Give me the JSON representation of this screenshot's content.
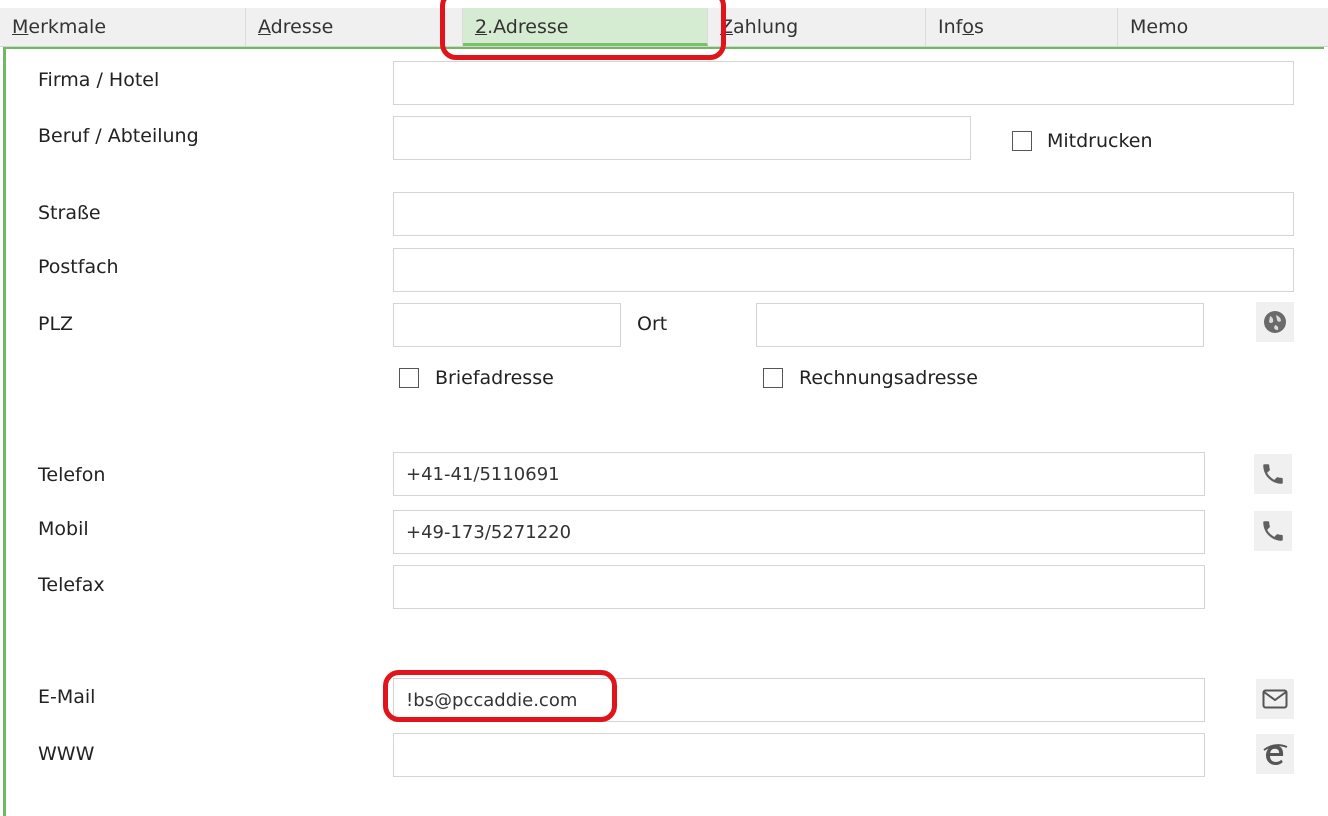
{
  "tabs": [
    {
      "pre": "",
      "ul": "M",
      "post": "erkmale"
    },
    {
      "pre": "",
      "ul": "A",
      "post": "dresse"
    },
    {
      "pre": "",
      "ul": "2",
      "post": ".Adresse"
    },
    {
      "pre": "",
      "ul": "Z",
      "post": "ahlung"
    },
    {
      "pre": "Inf",
      "ul": "o",
      "post": "s"
    },
    {
      "pre": "Memo",
      "ul": "",
      "post": ""
    }
  ],
  "form": {
    "firma_label": "Firma / Hotel",
    "beruf_label": "Beruf / Abteilung",
    "mitdrucken_label": "Mitdrucken",
    "strasse_label": "Straße",
    "postfach_label": "Postfach",
    "plz_label": "PLZ",
    "ort_label": "Ort",
    "briefadresse_label": "Briefadresse",
    "rechnungsadresse_label": "Rechnungsadresse",
    "telefon_label": "Telefon",
    "telefon_value": "+41-41/5110691",
    "mobil_label": "Mobil",
    "mobil_value": "+49-173/5271220",
    "telefax_label": "Telefax",
    "email_label": "E-Mail",
    "email_value": "!bs@pccaddie.com",
    "www_label": "WWW"
  },
  "colors": {
    "active_tab": "#d6ecd2",
    "panel_border": "#6dbb5e",
    "highlight": "#e0141a"
  },
  "icons": [
    "globe-icon",
    "phone-icon",
    "phone-icon",
    "envelope-icon",
    "browser-e-icon"
  ]
}
